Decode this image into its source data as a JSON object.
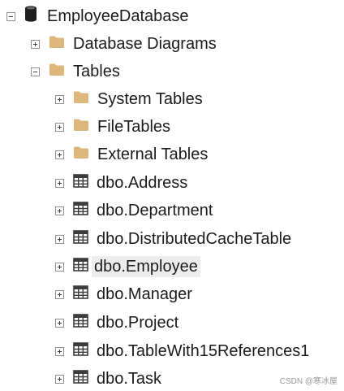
{
  "colors": {
    "folder": "#dcb67a",
    "table_icon": "#3c3c3c",
    "db_icon": "#1e1e1e",
    "selection": "#ececec"
  },
  "tree": {
    "root": {
      "label": "EmployeeDatabase",
      "icon": "database-icon",
      "toggle": "collapse"
    },
    "database_diagrams": {
      "label": "Database Diagrams",
      "icon": "folder-icon",
      "toggle": "expand"
    },
    "tables": {
      "label": "Tables",
      "icon": "folder-icon",
      "toggle": "collapse"
    },
    "system_tables": {
      "label": "System Tables",
      "icon": "folder-icon",
      "toggle": "expand"
    },
    "file_tables": {
      "label": "FileTables",
      "icon": "folder-icon",
      "toggle": "expand"
    },
    "external_tables": {
      "label": "External Tables",
      "icon": "folder-icon",
      "toggle": "expand"
    },
    "table_items": [
      {
        "label": "dbo.Address",
        "icon": "table-icon",
        "toggle": "expand",
        "selected": false
      },
      {
        "label": "dbo.Department",
        "icon": "table-icon",
        "toggle": "expand",
        "selected": false
      },
      {
        "label": "dbo.DistributedCacheTable",
        "icon": "table-icon",
        "toggle": "expand",
        "selected": false
      },
      {
        "label": "dbo.Employee",
        "icon": "table-icon",
        "toggle": "expand",
        "selected": true
      },
      {
        "label": "dbo.Manager",
        "icon": "table-icon",
        "toggle": "expand",
        "selected": false
      },
      {
        "label": "dbo.Project",
        "icon": "table-icon",
        "toggle": "expand",
        "selected": false
      },
      {
        "label": "dbo.TableWith15References1",
        "icon": "table-icon",
        "toggle": "expand",
        "selected": false
      },
      {
        "label": "dbo.Task",
        "icon": "table-icon",
        "toggle": "expand",
        "selected": false
      }
    ]
  },
  "watermark": "CSDN @寒冰屋"
}
